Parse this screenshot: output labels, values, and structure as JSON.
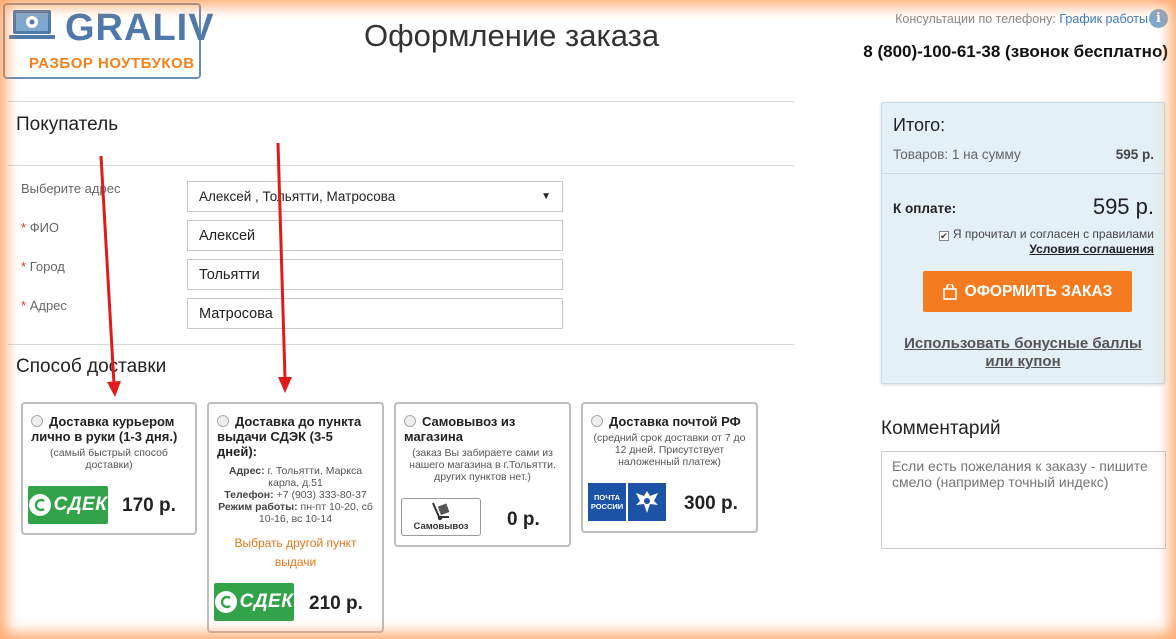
{
  "header": {
    "logo_text": "GRALIV",
    "logo_sub": "РАЗБОР НОУТБУКОВ",
    "page_title": "Оформление заказа",
    "consult_label": "Консультации по телефону:",
    "schedule_link": "График работы",
    "info_glyph": "i",
    "phone": "8 (800)-100-61-38 (звонок бесплатно)"
  },
  "buyer": {
    "title": "Покупатель",
    "address_select_label": "Выберите адрес",
    "address_select_value": "Алексей , Тольятти, Матросова",
    "required_mark": "*",
    "fields": [
      {
        "label": "ФИО",
        "value": "Алексей"
      },
      {
        "label": "Город",
        "value": "Тольятти"
      },
      {
        "label": "Адрес",
        "value": "Матросова"
      }
    ]
  },
  "delivery": {
    "title": "Способ доставки",
    "options": [
      {
        "title": "Доставка курьером лично в руки (1-3 дня.)",
        "note": "(самый быстрый способ доставки)",
        "price": "170 р.",
        "logo": "СДЕК"
      },
      {
        "title": "Доставка до пункта выдачи СДЭК (3-5 дней):",
        "address_label": "Адрес:",
        "address": "г. Тольятти, Маркса карла, д.51",
        "phone_label": "Телефон:",
        "phone": "+7 (903) 333-80-37",
        "hours_label": "Режим работы:",
        "hours": "пн-пт 10-20, сб 10-16, вс 10-14",
        "link": "Выбрать другой пункт выдачи",
        "price": "210 р.",
        "logo": "СДЕК"
      },
      {
        "title": "Самовывоз из магазина",
        "note": "(заказ Вы забираете сами из нашего магазина в г.Тольятти. других пунктов нет.)",
        "price": "0 р.",
        "logo": "Самовывоз"
      },
      {
        "title": "Доставка почтой РФ",
        "note": "(средний срок доставки от 7 до 12 дней. Присутствует наложенный платеж)",
        "price": "300 р.",
        "logo": "ПОЧТА РОССИИ"
      }
    ]
  },
  "summary": {
    "title": "Итого:",
    "goods_label": "Товаров: 1 на сумму",
    "goods_value": "595 р.",
    "pay_label": "К оплате:",
    "pay_value": "595 р.",
    "agree_text": "Я прочитал и согласен с правилами",
    "agree_check": "✔",
    "terms_link": "Условия соглашения",
    "order_button": "ОФОРМИТЬ ЗАКАЗ",
    "bonus_link": "Использовать бонусные баллы или купон"
  },
  "comment": {
    "title": "Комментарий",
    "placeholder": "Если есть пожелания к заказу - пишите смело (например точный индекс)"
  },
  "colors": {
    "accent_orange": "#f47b20",
    "brand_blue": "#4f79a8",
    "cdek_green": "#33a34a",
    "post_blue": "#1d53a6",
    "annotation_red": "#e01b1b"
  }
}
